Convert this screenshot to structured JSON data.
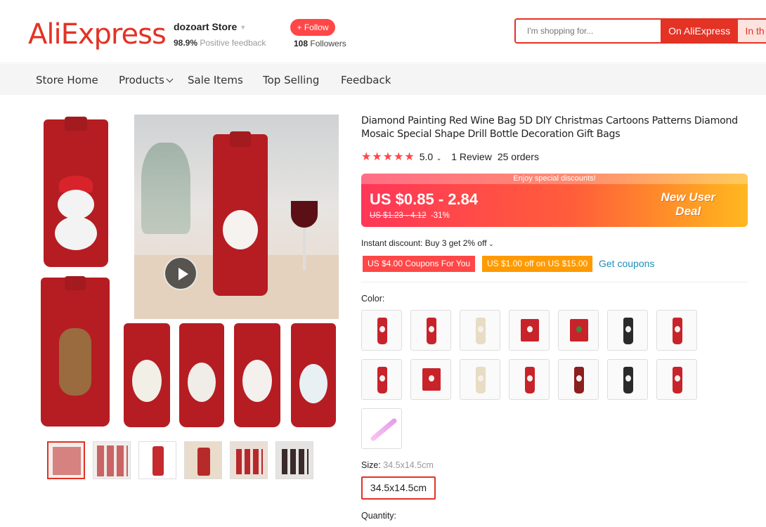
{
  "header": {
    "logo": "AliExpress",
    "store_name": "dozoart Store",
    "feedback_pct": "98.9%",
    "feedback_label": "Positive feedback",
    "follow_label": "+ Follow",
    "followers_count": "108",
    "followers_label": "Followers",
    "search_placeholder": "I'm shopping for...",
    "search_btn_aliexpress": "On AliExpress",
    "search_btn_store": "In th"
  },
  "nav": {
    "items": [
      "Store Home",
      "Products",
      "Sale Items",
      "Top Selling",
      "Feedback"
    ]
  },
  "product": {
    "title": "Diamond Painting Red Wine Bag 5D DIY Christmas Cartoons Patterns Diamond Mosaic Special Shape Drill Bottle Decoration Gift Bags",
    "stars": "★★★★★",
    "rating": "5.0",
    "reviews": "1 Review",
    "orders": "25 orders",
    "price_banner": "Enjoy special discounts!",
    "price": "US $0.85 - 2.84",
    "old_price": "US $1.23 - 4.12",
    "discount": "-31%",
    "new_user_deal_line1": "New User",
    "new_user_deal_line2": "Deal",
    "instant_discount": "Instant discount: Buy 3 get 2% off",
    "coupon1": "US $4.00 Coupons For You",
    "coupon2": "US $1.00 off on US $15.00",
    "get_coupons": "Get coupons",
    "color_label": "Color:",
    "size_label": "Size:",
    "size_value": "34.5x14.5cm",
    "size_option": "34.5x14.5cm",
    "quantity_label": "Quantity:"
  },
  "colors": {
    "brand_red": "#e43225",
    "accent_red": "#ff4747",
    "coupon_orange": "#ff9a00",
    "link_blue": "#1f8eb8"
  }
}
